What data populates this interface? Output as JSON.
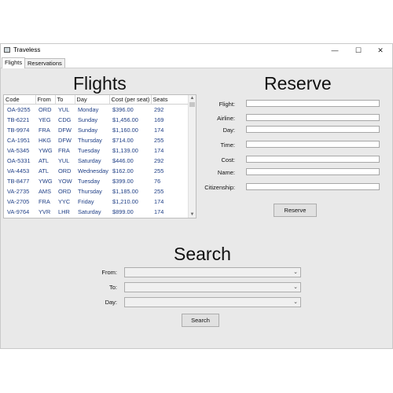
{
  "window": {
    "title": "Traveless",
    "minimize": "—",
    "maximize": "☐",
    "close": "✕"
  },
  "tabs": [
    {
      "label": "Flights",
      "active": true
    },
    {
      "label": "Reservations",
      "active": false
    }
  ],
  "flights": {
    "heading": "Flights",
    "columns": [
      "Code",
      "From",
      "To",
      "Day",
      "Cost (per seat)",
      "Seats"
    ],
    "rows": [
      [
        "OA-9255",
        "ORD",
        "YUL",
        "Monday",
        "$396.00",
        "292"
      ],
      [
        "TB-6221",
        "YEG",
        "CDG",
        "Sunday",
        "$1,456.00",
        "169"
      ],
      [
        "TB-9974",
        "FRA",
        "DFW",
        "Sunday",
        "$1,160.00",
        "174"
      ],
      [
        "CA-1951",
        "HKG",
        "DFW",
        "Thursday",
        "$714.00",
        "255"
      ],
      [
        "VA-5345",
        "YWG",
        "FRA",
        "Tuesday",
        "$1,139.00",
        "174"
      ],
      [
        "OA-5331",
        "ATL",
        "YUL",
        "Saturday",
        "$446.00",
        "292"
      ],
      [
        "VA-4453",
        "ATL",
        "ORD",
        "Wednesday",
        "$162.00",
        "255"
      ],
      [
        "TB-8477",
        "YWG",
        "YOW",
        "Tuesday",
        "$399.00",
        "76"
      ],
      [
        "VA-2735",
        "AMS",
        "ORD",
        "Thursday",
        "$1,185.00",
        "255"
      ],
      [
        "VA-2705",
        "FRA",
        "YYC",
        "Friday",
        "$1,210.00",
        "174"
      ],
      [
        "VA-9764",
        "YVR",
        "LHR",
        "Saturday",
        "$899.00",
        "174"
      ]
    ]
  },
  "reserve": {
    "heading": "Reserve",
    "fields": [
      {
        "label": "Flight:",
        "value": ""
      },
      {
        "label": "Airline:",
        "value": ""
      },
      {
        "label": "Day:",
        "value": ""
      },
      {
        "label": "Time:",
        "value": ""
      },
      {
        "label": "Cost:",
        "value": ""
      },
      {
        "label": "Name:",
        "value": ""
      },
      {
        "label": "Citizenship:",
        "value": ""
      }
    ],
    "button": "Reserve"
  },
  "search": {
    "heading": "Search",
    "from_label": "From:",
    "to_label": "To:",
    "day_label": "Day:",
    "from_value": "",
    "to_value": "",
    "day_value": "",
    "button": "Search"
  },
  "icons": {
    "scroll_up": "chevron-up-icon",
    "scroll_down": "chevron-down-icon",
    "dropdown": "chevron-down-icon"
  }
}
